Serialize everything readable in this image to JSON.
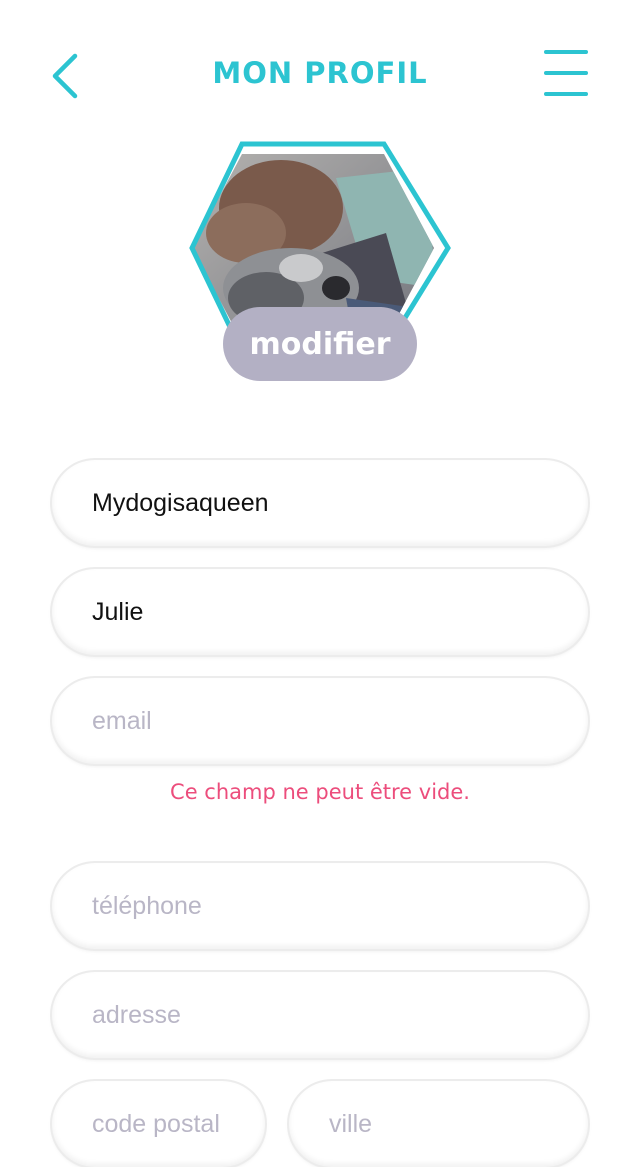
{
  "header": {
    "title": "MON PROFIL",
    "back_icon": "chevron-left-icon",
    "menu_icon": "hamburger-menu-icon"
  },
  "profile": {
    "photo_icon": "profile-photo",
    "modify_label": "modifier"
  },
  "form": {
    "username": {
      "value": "Mydogisaqueen"
    },
    "firstname": {
      "value": "Julie"
    },
    "email": {
      "value": "",
      "placeholder": "email"
    },
    "email_error": "Ce champ ne peut être vide.",
    "phone": {
      "value": "",
      "placeholder": "téléphone"
    },
    "address": {
      "value": "",
      "placeholder": "adresse"
    },
    "postal_code": {
      "value": "",
      "placeholder": "code postal"
    },
    "city": {
      "value": "",
      "placeholder": "ville"
    }
  },
  "colors": {
    "accent": "#2cc4d1",
    "button": "#b3b0c4",
    "error": "#ec4d7c",
    "placeholder": "#b9b6c6"
  }
}
